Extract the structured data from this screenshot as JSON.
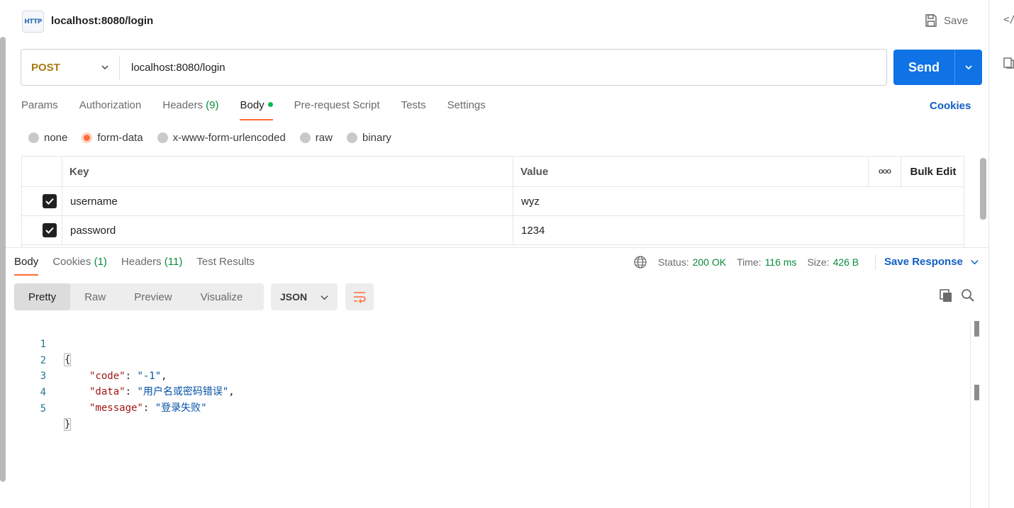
{
  "header": {
    "title": "localhost:8080/login",
    "save_label": "Save",
    "http_badge": "HTTP"
  },
  "right_rail": {
    "icons": [
      "code-icon",
      "docs-icon"
    ],
    "code_glyph": "</"
  },
  "request": {
    "method": "POST",
    "url": "localhost:8080/login",
    "send_label": "Send"
  },
  "request_tabs": [
    {
      "label": "Params",
      "count": ""
    },
    {
      "label": "Authorization",
      "count": ""
    },
    {
      "label": "Headers",
      "count": "(9)"
    },
    {
      "label": "Body",
      "count": "",
      "active": true
    },
    {
      "label": "Pre-request Script",
      "count": ""
    },
    {
      "label": "Tests",
      "count": ""
    },
    {
      "label": "Settings",
      "count": ""
    }
  ],
  "cookies_label": "Cookies",
  "body_types": [
    {
      "label": "none",
      "selected": false
    },
    {
      "label": "form-data",
      "selected": true
    },
    {
      "label": "x-www-form-urlencoded",
      "selected": false
    },
    {
      "label": "raw",
      "selected": false
    },
    {
      "label": "binary",
      "selected": false
    }
  ],
  "params_table": {
    "headers": {
      "key": "Key",
      "value": "Value",
      "more": "ooo",
      "bulk_edit": "Bulk Edit"
    },
    "rows": [
      {
        "checked": true,
        "key": "username",
        "value": "wyz"
      },
      {
        "checked": true,
        "key": "password",
        "value": "1234"
      }
    ]
  },
  "response": {
    "tabs": [
      {
        "label": "Body",
        "count": ""
      },
      {
        "label": "Cookies",
        "count": "(1)"
      },
      {
        "label": "Headers",
        "count": "(11)"
      },
      {
        "label": "Test Results",
        "count": ""
      }
    ],
    "status_label": "Status:",
    "status_value": "200 OK",
    "time_label": "Time:",
    "time_value": "116 ms",
    "size_label": "Size:",
    "size_value": "426 B",
    "save_response_label": "Save Response",
    "view_modes": [
      "Pretty",
      "Raw",
      "Preview",
      "Visualize"
    ],
    "format": "JSON",
    "lines": [
      {
        "num": "1",
        "text": "{"
      },
      {
        "num": "2",
        "key": "\"code\"",
        "value": "\"-1\"",
        "trail": ","
      },
      {
        "num": "3",
        "key": "\"data\"",
        "value": "\"用户名或密码错误\"",
        "trail": ","
      },
      {
        "num": "4",
        "key": "\"message\"",
        "value": "\"登录失败\"",
        "trail": ""
      },
      {
        "num": "5",
        "text": "}"
      }
    ]
  },
  "colors": {
    "accent": "#ff6c37",
    "send": "#0f72e5",
    "method": "#a77a12",
    "success": "#0a8a3c",
    "link": "#0f5fc4"
  }
}
